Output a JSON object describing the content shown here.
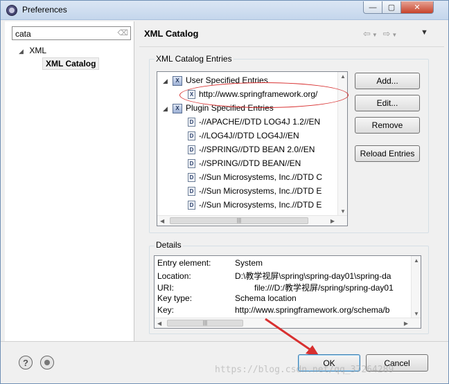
{
  "window": {
    "title": "Preferences",
    "controls": {
      "minimize": "—",
      "maximize": "▢",
      "close": "✕"
    }
  },
  "left_pane": {
    "filter_value": "cata",
    "filter_clear_icon": "eraser-icon",
    "tree": [
      {
        "label": "XML",
        "expanded": true
      },
      {
        "label": "XML Catalog",
        "selected": true
      }
    ]
  },
  "header": {
    "title": "XML Catalog",
    "nav": {
      "back": "⇦",
      "forward": "⇨",
      "menu": "▼"
    }
  },
  "entries": {
    "group_label": "XML Catalog Entries",
    "items": [
      {
        "label": "User Specified Entries",
        "kind": "group",
        "expanded": true
      },
      {
        "label": "http://www.springframework.org/",
        "kind": "xml-file",
        "highlighted": true
      },
      {
        "label": "Plugin Specified Entries",
        "kind": "group",
        "expanded": true
      },
      {
        "label": "-//APACHE//DTD LOG4J 1.2//EN",
        "kind": "dtd-file"
      },
      {
        "label": "-//LOG4J//DTD LOG4J//EN",
        "kind": "dtd-file"
      },
      {
        "label": "-//SPRING//DTD BEAN 2.0//EN",
        "kind": "dtd-file"
      },
      {
        "label": "-//SPRING//DTD BEAN//EN",
        "kind": "dtd-file"
      },
      {
        "label": "-//Sun Microsystems, Inc.//DTD C",
        "kind": "dtd-file"
      },
      {
        "label": "-//Sun Microsystems, Inc.//DTD E",
        "kind": "dtd-file"
      },
      {
        "label": "-//Sun Microsystems, Inc.//DTD E",
        "kind": "dtd-file"
      }
    ],
    "buttons": {
      "add": "Add...",
      "edit": "Edit...",
      "remove": "Remove",
      "reload": "Reload Entries"
    }
  },
  "details": {
    "group_label": "Details",
    "rows": [
      {
        "key": "Entry element:",
        "value": "System"
      },
      {
        "key": "Location:",
        "value": "D:\\教学视屏\\spring\\spring-day01\\spring-da"
      },
      {
        "key": "URI:",
        "value": "file:///D:/教学视屏/spring/spring-day01"
      },
      {
        "key": "Key type:",
        "value": "Schema location"
      },
      {
        "key": "Key:",
        "value": "http://www.springframework.org/schema/b"
      }
    ]
  },
  "footer": {
    "ok": "OK",
    "cancel": "Cancel",
    "watermark": "https://blog.csdn.net/qq_37264289"
  },
  "colors": {
    "annotation_red": "#d83030",
    "titlebar": "#c4d6ec",
    "default_button_border": "#3c7fb1"
  }
}
